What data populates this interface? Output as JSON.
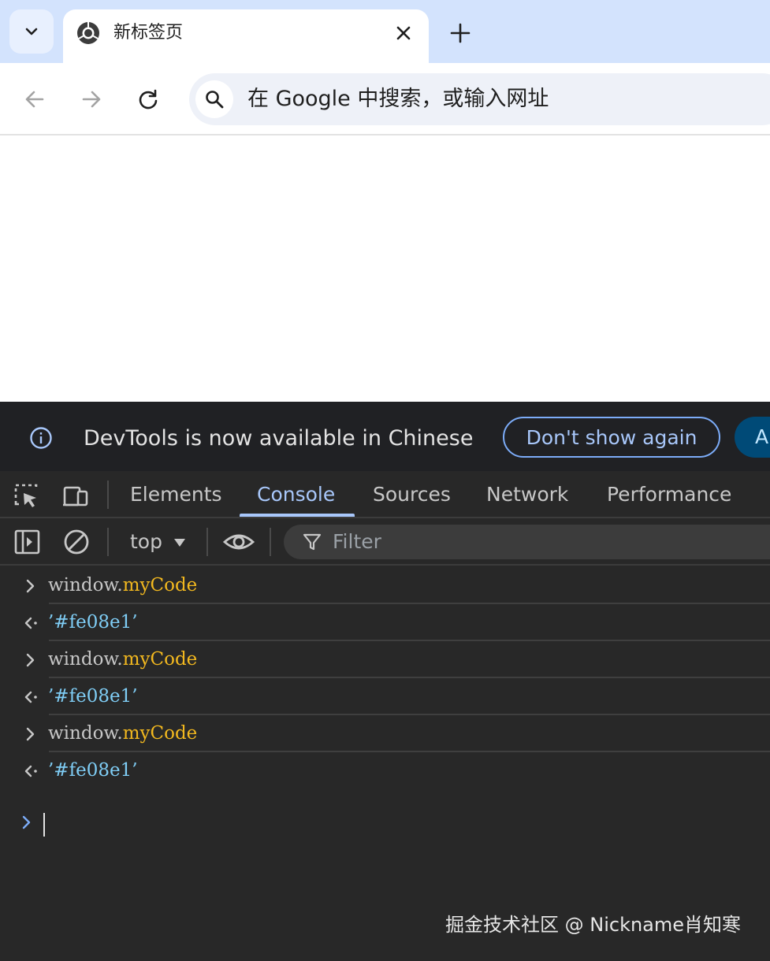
{
  "browser": {
    "tab": {
      "title": "新标签页",
      "favicon": "chrome-icon"
    },
    "omnibox": {
      "placeholder": "在 Google 中搜索，或输入网址"
    }
  },
  "devtools": {
    "infobar": {
      "message": "DevTools is now available in Chinese",
      "dont_show_label": "Don't show again",
      "action_label": "A"
    },
    "panel_tabs": [
      "Elements",
      "Console",
      "Sources",
      "Network",
      "Performance"
    ],
    "active_tab": "Console",
    "console_toolbar": {
      "context": "top",
      "filter_placeholder": "Filter"
    },
    "console_entries": [
      {
        "type": "input",
        "object": "window.",
        "property": "myCode"
      },
      {
        "type": "output",
        "value": "’#fe08e1’"
      },
      {
        "type": "input",
        "object": "window.",
        "property": "myCode"
      },
      {
        "type": "output",
        "value": "’#fe08e1’"
      },
      {
        "type": "input",
        "object": "window.",
        "property": "myCode"
      },
      {
        "type": "output",
        "value": "’#fe08e1’"
      }
    ]
  },
  "watermark": "掘金技术社区 @ Nickname肖知寒",
  "colors": {
    "tabstrip_bg": "#d3e3fd",
    "devtools_bg": "#282828",
    "accent": "#a8c7fa",
    "property": "#f2b81f",
    "string": "#7fcdf5"
  }
}
